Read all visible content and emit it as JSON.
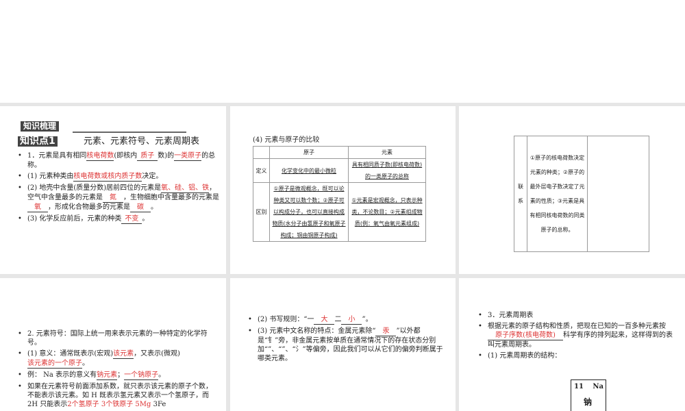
{
  "slides": {
    "s1": {
      "section_header": "知识梳理",
      "kp_badge": "知识点1",
      "kp_title": "元素、元素符号、元素周期表",
      "items": [
        {
          "pre": "1．元素是具有相同",
          "a1": "核电荷数",
          "mid": "(即核内",
          "a2": "质子",
          "post": "数)的",
          "a3": "一类原子",
          "post2": "的总称。"
        },
        {
          "pre": "(1) 元素种类由",
          "a1": "核电荷数或核内质子数",
          "post": "决定。"
        },
        {
          "pre": "(2) 地壳中含量(质量分数)居前四位的元素是",
          "a1": "氧、硅、铝、铁",
          "mid": "，空气中含量最多的元素是",
          "a2": "氮",
          "mid2": "，生物细胞中含量最多的元素是",
          "a3": "氧",
          "mid3": "，形成化合物最多的元素是",
          "a4": "碳",
          "post": "。"
        },
        {
          "pre": "(3) 化学反应前后，元素的种类",
          "a1": "不变",
          "post": "。"
        }
      ]
    },
    "s2": {
      "caption": "(4) 元素与原子的比较",
      "headers": [
        "",
        "原子",
        "元素"
      ],
      "rows": [
        {
          "label": "定义",
          "atom": "化学变化中的最小微粒",
          "element": "具有相同质子数(即核电荷数)的一类原子的总称"
        },
        {
          "label": "区别",
          "atom": "①原子是微观概念，既可以论种类又可以数个数；②原子可以构成分子，也可以直接构成物质(水分子由氢原子和氧原子构成；铜由铜原子构成)",
          "element": "①元素是宏观概念，只表示种类，不论数目；②元素组成物质(例：氧气由氧元素组成)"
        }
      ]
    },
    "s3": {
      "label": "联系",
      "text": "①原子的核电荷数决定元素的种类；②原子的最外层电子数决定了元素的性质；③元素是具有相同核电荷数的同类原子的总称。"
    },
    "s4": {
      "items": [
        {
          "text": "2. 元素符号：国际上统一用来表示元素的一种特定的化学符号。"
        },
        {
          "pre": "(1) 意义：通常既表示(宏观)",
          "a1": "该元素",
          "mid": "，又表示(微观)",
          "a2": "该元素的一个原子",
          "post": "。"
        },
        {
          "pre": "例： Na 表示的意义有",
          "a1": "钠元素",
          "mid": "；",
          "a2": "一个钠原子",
          "post": "。"
        },
        {
          "pre": "如果在元素符号前面添加系数，就只表示该元素的原子个数，不能表示该元素。如 H 既表示氢元素又表示一个氢原子，而 2H 只能表示",
          "a1": "2个氢原子",
          "a2": "3个铁原子",
          "a3": "5Mg",
          "post": "3Fe"
        }
      ]
    },
    "s5": {
      "items": [
        {
          "pre": "(2) 书写规则：“一",
          "a1": "大",
          "mid": "二",
          "a2": "小",
          "post": "”。"
        },
        {
          "pre": "(3) 元素中文名称的特点：金属元素除“",
          "a1": "汞",
          "post": "”以外都是“钅”旁，非金属元素按单质在通常情况下的存在状态分别加“”、“”、“氵”等偏旁，因此我们可以从它们的偏旁判断属于哪类元素。"
        }
      ]
    },
    "s6": {
      "items": [
        {
          "text": "3．元素周期表"
        },
        {
          "pre": "根据元素的原子结构和性质，把现在已知的一百多种元素按",
          "a1": "原子序数(核电荷数)",
          "post": "科学有序的排列起来，这样得到的表叫元素周期表。"
        },
        {
          "text": "(1) 元素周期表的结构："
        }
      ],
      "cell": {
        "number": "11",
        "symbol": "Na",
        "name": "钠"
      }
    }
  }
}
